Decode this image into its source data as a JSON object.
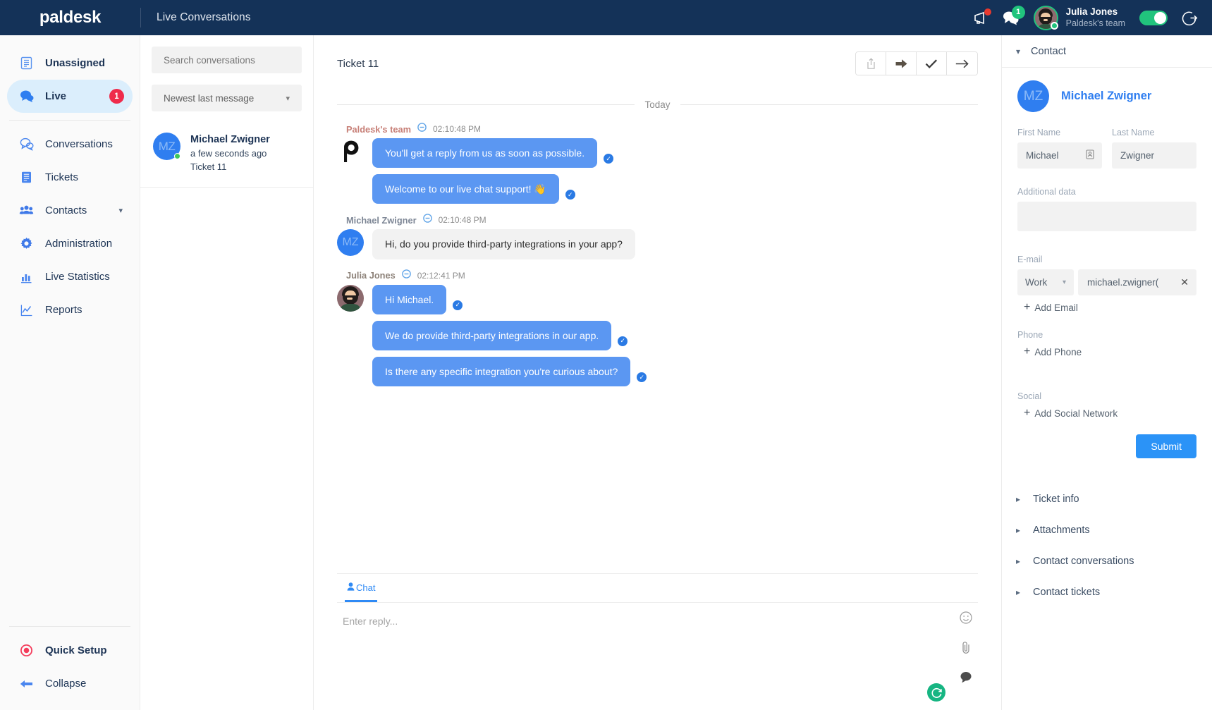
{
  "topbar": {
    "brand": "paldesk",
    "title": "Live Conversations",
    "megaphone_icon": "megaphone-icon",
    "chat_icon": "chat-bubbles-icon",
    "chat_badge": "1",
    "user_name": "Julia Jones",
    "user_team": "Paldesk's team",
    "status_toggle": "online-toggle",
    "logout_icon": "logout-icon"
  },
  "sidebar": {
    "items": [
      {
        "label": "Unassigned",
        "icon": "unassigned-list-icon"
      },
      {
        "label": "Live",
        "icon": "live-chat-icon",
        "badge": "1"
      },
      {
        "label": "Conversations",
        "icon": "conversations-icon"
      },
      {
        "label": "Tickets",
        "icon": "tickets-icon"
      },
      {
        "label": "Contacts",
        "icon": "contacts-icon",
        "caret": "⌄"
      },
      {
        "label": "Administration",
        "icon": "gear-icon"
      },
      {
        "label": "Live Statistics",
        "icon": "bar-chart-icon"
      },
      {
        "label": "Reports",
        "icon": "line-chart-icon"
      }
    ],
    "quick_setup": "Quick Setup",
    "collapse": "Collapse"
  },
  "conversations": {
    "search_placeholder": "Search conversations",
    "sort_value": "Newest last message",
    "items": [
      {
        "initials": "MZ",
        "name": "Michael Zwigner",
        "time": "a few seconds ago",
        "ticket": "Ticket 11"
      }
    ]
  },
  "chat": {
    "title": "Ticket 11",
    "actions": [
      {
        "name": "export-button",
        "glyph": "⇧"
      },
      {
        "name": "forward-button",
        "glyph": "➡"
      },
      {
        "name": "resolve-button",
        "glyph": "✓"
      },
      {
        "name": "next-button",
        "glyph": "→"
      }
    ],
    "day_separator": "Today",
    "groups": [
      {
        "author": "Paldesk's team",
        "author_class": "team",
        "time": "02:10:48 PM",
        "avatar": "paldesk-logo-avatar",
        "initials": "",
        "messages": [
          {
            "text": "You'll get a reply from us as soon as possible.",
            "direction": "out",
            "read": true
          },
          {
            "text": "Welcome to our live chat support! 👋",
            "direction": "out",
            "read": true
          }
        ]
      },
      {
        "author": "Michael Zwigner",
        "author_class": "contact",
        "time": "02:10:48 PM",
        "avatar": "contact-avatar",
        "initials": "MZ",
        "messages": [
          {
            "text": "Hi, do you provide third-party integrations in your app?",
            "direction": "in",
            "read": false
          }
        ]
      },
      {
        "author": "Julia Jones",
        "author_class": "agent",
        "time": "02:12:41 PM",
        "avatar": "agent-avatar",
        "initials": "",
        "messages": [
          {
            "text": "Hi Michael.",
            "direction": "out",
            "read": true
          },
          {
            "text": "We do provide third-party integrations in our app.",
            "direction": "out",
            "read": true
          },
          {
            "text": "Is there any specific integration you're curious about?",
            "direction": "out",
            "read": true
          }
        ]
      }
    ],
    "reply_tab": "Chat",
    "reply_placeholder": "Enter reply...",
    "emoji_icon": "emoji-icon",
    "attach_icon": "paperclip-icon",
    "canned_icon": "canned-response-icon",
    "send_icon": "send-icon"
  },
  "contact_panel": {
    "header": "Contact",
    "initials": "MZ",
    "name": "Michael Zwigner",
    "first_name_label": "First Name",
    "first_name_value": "Michael",
    "last_name_label": "Last Name",
    "last_name_value": "Zwigner",
    "additional_label": "Additional data",
    "additional_value": "",
    "email_label": "E-mail",
    "email_type": "Work",
    "email_value": "michael.zwigner(",
    "add_email": "Add Email",
    "phone_label": "Phone",
    "add_phone": "Add Phone",
    "social_label": "Social",
    "add_social": "Add Social Network",
    "submit": "Submit",
    "accordions": [
      {
        "label": "Ticket info"
      },
      {
        "label": "Attachments"
      },
      {
        "label": "Contact conversations"
      },
      {
        "label": "Contact tickets"
      }
    ]
  },
  "colors": {
    "navy": "#143258",
    "accent_blue": "#2f7ef0",
    "bubble_out": "#5b97f2",
    "bubble_in": "#f2f2f2",
    "green": "#21c47d",
    "red_badge": "#ef2b4b",
    "submit_blue": "#2b93f7"
  }
}
